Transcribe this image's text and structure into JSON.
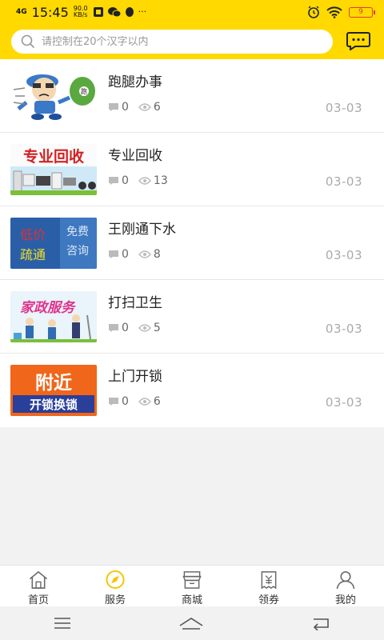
{
  "status_bar": {
    "network": "4G",
    "net_speed_value": "90.0",
    "net_speed_unit": "KB/s",
    "time": "15:45",
    "more": "···",
    "battery": "9"
  },
  "search": {
    "placeholder": "请控制在20个汉字以内"
  },
  "services": [
    {
      "title": "跑腿办事",
      "comments": "0",
      "views": "6",
      "date": "03-03"
    },
    {
      "title": "专业回收",
      "comments": "0",
      "views": "13",
      "date": "03-03"
    },
    {
      "title": "王刚通下水",
      "comments": "0",
      "views": "8",
      "date": "03-03"
    },
    {
      "title": "打扫卫生",
      "comments": "0",
      "views": "5",
      "date": "03-03"
    },
    {
      "title": "上门开锁",
      "comments": "0",
      "views": "6",
      "date": "03-03"
    }
  ],
  "thumbs": {
    "recycle": "专业回收",
    "plumb_left": [
      "低价",
      "疏通"
    ],
    "plumb_right": [
      "免费",
      "咨询"
    ],
    "clean": "家政服务",
    "lock_top": "附近",
    "lock_bottom": "开锁换锁",
    "bag_tag": "跑"
  },
  "tabs": [
    {
      "label": "首页",
      "icon": "home-icon"
    },
    {
      "label": "服务",
      "icon": "compass-icon",
      "active": true
    },
    {
      "label": "商城",
      "icon": "store-icon"
    },
    {
      "label": "领券",
      "icon": "coupon-icon"
    },
    {
      "label": "我的",
      "icon": "user-icon"
    }
  ],
  "colors": {
    "brand_yellow": "#ffd900",
    "active_icon": "#f5c400",
    "date_gray": "#aaaaaa"
  }
}
